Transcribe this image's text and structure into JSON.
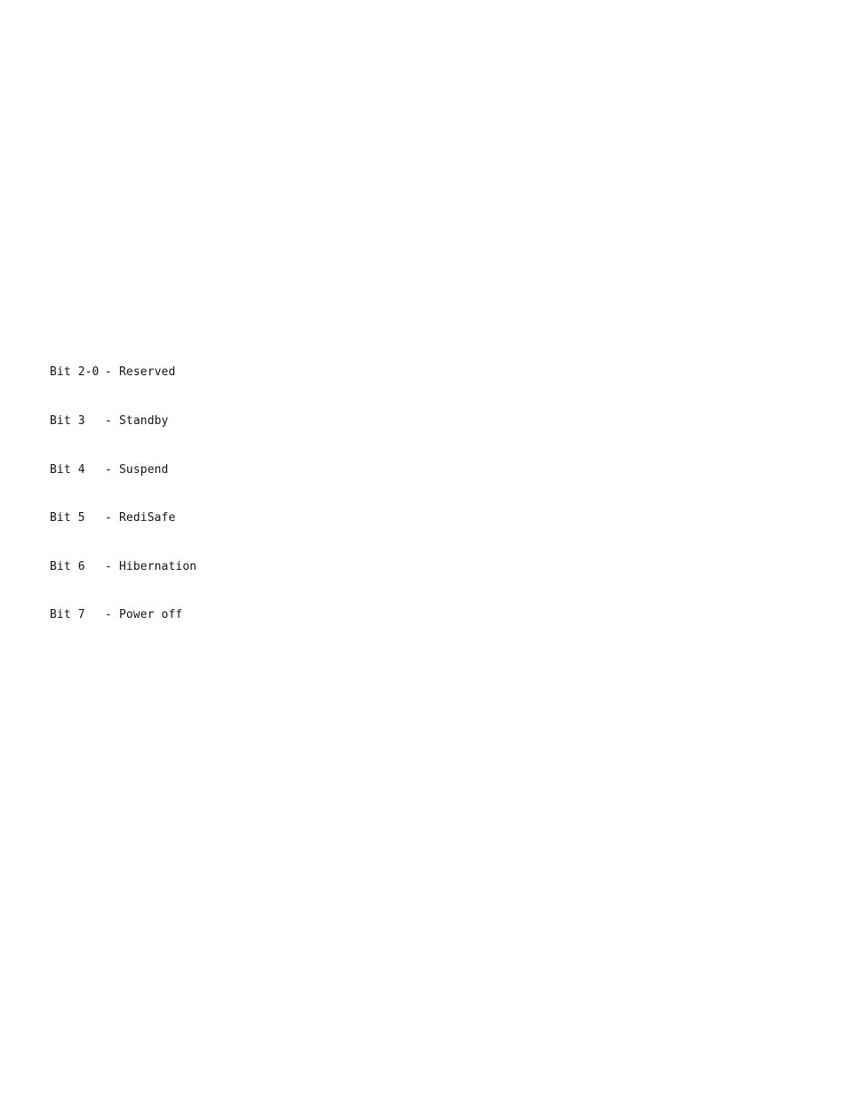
{
  "bit_definitions": [
    {
      "bits": "Bit 2-0",
      "separator": "-",
      "meaning": "Reserved"
    },
    {
      "bits": "Bit 3",
      "separator": "-",
      "meaning": "Standby"
    },
    {
      "bits": "Bit 4",
      "separator": "-",
      "meaning": "Suspend"
    },
    {
      "bits": "Bit 5",
      "separator": "-",
      "meaning": "RediSafe"
    },
    {
      "bits": "Bit 6",
      "separator": "-",
      "meaning": "Hibernation"
    },
    {
      "bits": "Bit 7",
      "separator": "-",
      "meaning": "Power off"
    }
  ]
}
